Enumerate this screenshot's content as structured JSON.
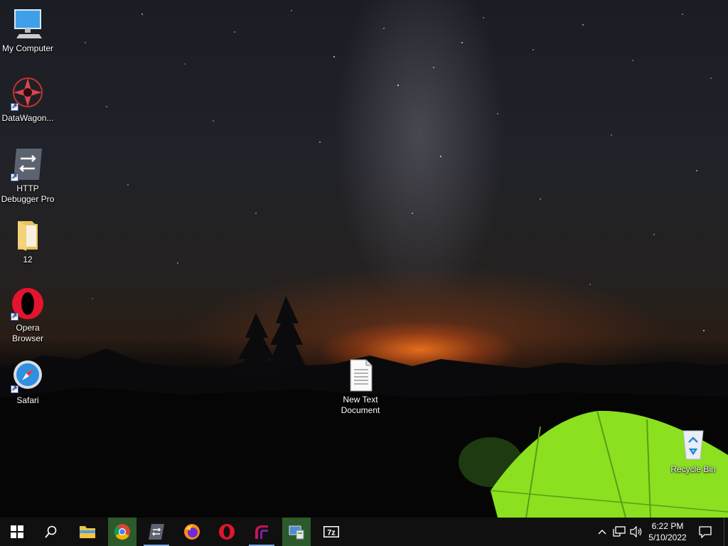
{
  "desktop": {
    "icons": [
      {
        "name": "My Computer"
      },
      {
        "name": "DataWagon..."
      },
      {
        "name_line1": "HTTP",
        "name_line2": "Debugger Pro"
      },
      {
        "name": "12"
      },
      {
        "name_line1": "Opera",
        "name_line2": "Browser"
      },
      {
        "name": "Safari"
      },
      {
        "name_line1": "New Text",
        "name_line2": "Document"
      },
      {
        "name": "Recycle Bin"
      }
    ]
  },
  "taskbar": {
    "items": [
      "start-icon",
      "search-icon",
      "file-explorer-icon",
      "chrome-icon",
      "http-debugger-icon",
      "firefox-icon",
      "opera-icon",
      "datawagon-icon",
      "control-panel-icon",
      "7zip-icon"
    ],
    "clock": {
      "time": "6:22 PM",
      "date": "5/10/2022"
    }
  },
  "colors": {
    "taskbar": "#101010",
    "active_highlight": "#2c5a2c",
    "tent": "#8be020"
  }
}
